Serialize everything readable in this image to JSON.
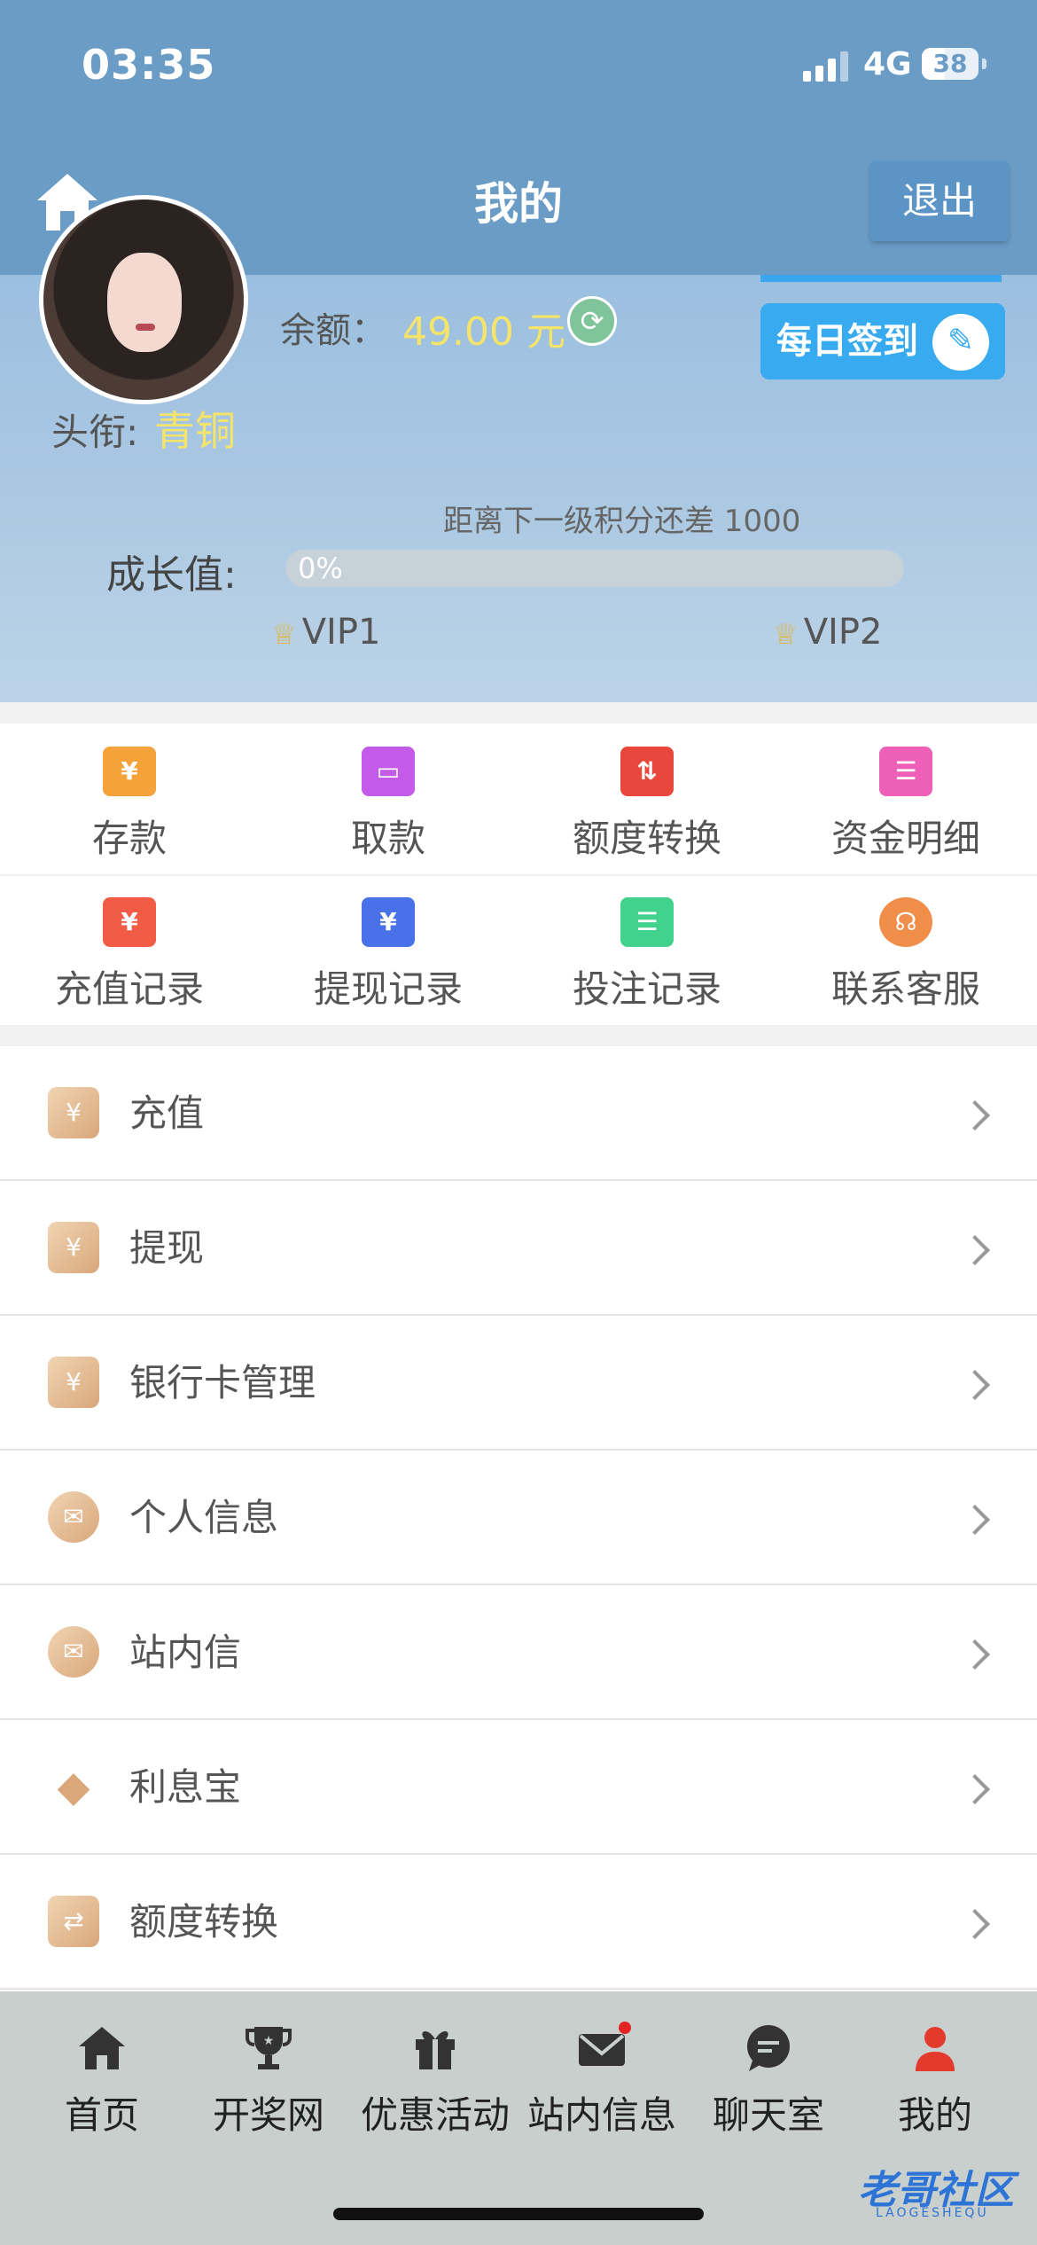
{
  "status_bar": {
    "time": "03:35",
    "network": "4G",
    "battery": "38"
  },
  "nav": {
    "title": "我的",
    "logout_label": "退出"
  },
  "profile": {
    "balance_label": "余额：",
    "balance_value": "49.00 元",
    "signin_label": "每日签到",
    "rank_label": "头衔:",
    "rank_value": "青铜",
    "next_level_text": "距离下一级积分还差 1000",
    "growth_label": "成长值:",
    "growth_progress_text": "0%",
    "growth_progress": 0,
    "vip_current": "VIP1",
    "vip_next": "VIP2"
  },
  "quick_actions": [
    {
      "label": "存款",
      "icon": "yen-card-icon",
      "color": "#f5a23a"
    },
    {
      "label": "取款",
      "icon": "card-withdraw-icon",
      "color": "#c45ae8"
    },
    {
      "label": "额度转换",
      "icon": "transfer-icon",
      "color": "#e9463c"
    },
    {
      "label": "资金明细",
      "icon": "clipboard-icon",
      "color": "#ee5fb8"
    },
    {
      "label": "充值记录",
      "icon": "down-arrow-yen-icon",
      "color": "#f25b46"
    },
    {
      "label": "提现记录",
      "icon": "up-arrow-yen-icon",
      "color": "#4a72e8"
    },
    {
      "label": "投注记录",
      "icon": "clipboard-green-icon",
      "color": "#43d18e"
    },
    {
      "label": "联系客服",
      "icon": "headset-icon",
      "color": "#f08e4a"
    }
  ],
  "menu": [
    {
      "label": "充值",
      "icon": "recharge-icon"
    },
    {
      "label": "提现",
      "icon": "withdraw-icon"
    },
    {
      "label": "银行卡管理",
      "icon": "money-bag-icon"
    },
    {
      "label": "个人信息",
      "icon": "mail-icon"
    },
    {
      "label": "站内信",
      "icon": "mail-icon"
    },
    {
      "label": "利息宝",
      "icon": "diamond-icon"
    },
    {
      "label": "额度转换",
      "icon": "transfer-icon"
    }
  ],
  "tabs": [
    {
      "label": "首页",
      "icon": "home-icon"
    },
    {
      "label": "开奖网",
      "icon": "trophy-icon"
    },
    {
      "label": "优惠活动",
      "icon": "gift-icon"
    },
    {
      "label": "站内信息",
      "icon": "envelope-icon"
    },
    {
      "label": "聊天室",
      "icon": "chat-icon"
    },
    {
      "label": "我的",
      "icon": "user-icon"
    }
  ],
  "watermark": {
    "text": "老哥社区",
    "sub": "LAOGESHEQU"
  }
}
